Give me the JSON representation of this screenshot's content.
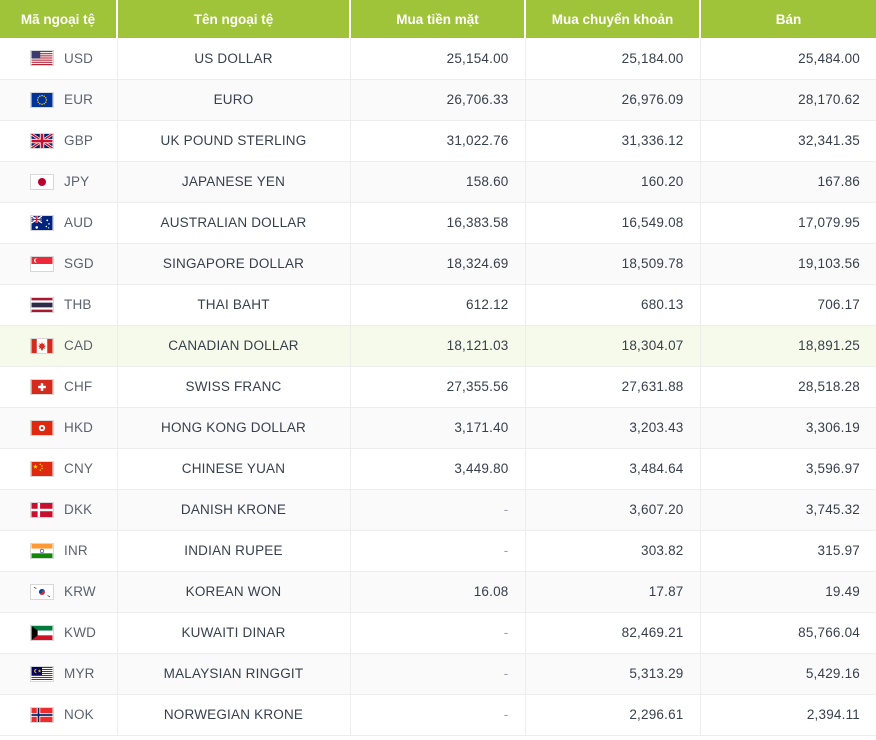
{
  "table": {
    "columns": [
      {
        "key": "code",
        "label": "Mã ngoại tệ",
        "align": "left"
      },
      {
        "key": "name",
        "label": "Tên ngoại tệ",
        "align": "center"
      },
      {
        "key": "cash",
        "label": "Mua tiền mặt",
        "align": "right"
      },
      {
        "key": "trans",
        "label": "Mua chuyển khoản",
        "align": "right"
      },
      {
        "key": "sell",
        "label": "Bán",
        "align": "right"
      }
    ],
    "header_bg": "#9fc339",
    "header_text_color": "#ffffff",
    "row_alt_bg": "#fafafa",
    "row_highlight_bg": "#f5faea",
    "body_text_color": "#37404d",
    "dash_placeholder": "-",
    "rows": [
      {
        "flag": "flag-us",
        "code": "USD",
        "name": "US DOLLAR",
        "cash": "25,154.00",
        "trans": "25,184.00",
        "sell": "25,484.00",
        "highlight": false
      },
      {
        "flag": "flag-eu",
        "code": "EUR",
        "name": "EURO",
        "cash": "26,706.33",
        "trans": "26,976.09",
        "sell": "28,170.62",
        "highlight": false
      },
      {
        "flag": "flag-gb",
        "code": "GBP",
        "name": "UK POUND STERLING",
        "cash": "31,022.76",
        "trans": "31,336.12",
        "sell": "32,341.35",
        "highlight": false
      },
      {
        "flag": "flag-jp",
        "code": "JPY",
        "name": "JAPANESE YEN",
        "cash": "158.60",
        "trans": "160.20",
        "sell": "167.86",
        "highlight": false
      },
      {
        "flag": "flag-au",
        "code": "AUD",
        "name": "AUSTRALIAN DOLLAR",
        "cash": "16,383.58",
        "trans": "16,549.08",
        "sell": "17,079.95",
        "highlight": false
      },
      {
        "flag": "flag-sg",
        "code": "SGD",
        "name": "SINGAPORE DOLLAR",
        "cash": "18,324.69",
        "trans": "18,509.78",
        "sell": "19,103.56",
        "highlight": false
      },
      {
        "flag": "flag-th",
        "code": "THB",
        "name": "THAI BAHT",
        "cash": "612.12",
        "trans": "680.13",
        "sell": "706.17",
        "highlight": false
      },
      {
        "flag": "flag-ca",
        "code": "CAD",
        "name": "CANADIAN DOLLAR",
        "cash": "18,121.03",
        "trans": "18,304.07",
        "sell": "18,891.25",
        "highlight": true
      },
      {
        "flag": "flag-ch",
        "code": "CHF",
        "name": "SWISS FRANC",
        "cash": "27,355.56",
        "trans": "27,631.88",
        "sell": "28,518.28",
        "highlight": false
      },
      {
        "flag": "flag-hk",
        "code": "HKD",
        "name": "HONG KONG DOLLAR",
        "cash": "3,171.40",
        "trans": "3,203.43",
        "sell": "3,306.19",
        "highlight": false
      },
      {
        "flag": "flag-cn",
        "code": "CNY",
        "name": "CHINESE YUAN",
        "cash": "3,449.80",
        "trans": "3,484.64",
        "sell": "3,596.97",
        "highlight": false
      },
      {
        "flag": "flag-dk",
        "code": "DKK",
        "name": "DANISH KRONE",
        "cash": "-",
        "trans": "3,607.20",
        "sell": "3,745.32",
        "highlight": false
      },
      {
        "flag": "flag-in",
        "code": "INR",
        "name": "INDIAN RUPEE",
        "cash": "-",
        "trans": "303.82",
        "sell": "315.97",
        "highlight": false
      },
      {
        "flag": "flag-kr",
        "code": "KRW",
        "name": "KOREAN WON",
        "cash": "16.08",
        "trans": "17.87",
        "sell": "19.49",
        "highlight": false
      },
      {
        "flag": "flag-kw",
        "code": "KWD",
        "name": "KUWAITI DINAR",
        "cash": "-",
        "trans": "82,469.21",
        "sell": "85,766.04",
        "highlight": false
      },
      {
        "flag": "flag-my",
        "code": "MYR",
        "name": "MALAYSIAN RINGGIT",
        "cash": "-",
        "trans": "5,313.29",
        "sell": "5,429.16",
        "highlight": false
      },
      {
        "flag": "flag-no",
        "code": "NOK",
        "name": "NORWEGIAN KRONE",
        "cash": "-",
        "trans": "2,296.61",
        "sell": "2,394.11",
        "highlight": false
      }
    ]
  }
}
